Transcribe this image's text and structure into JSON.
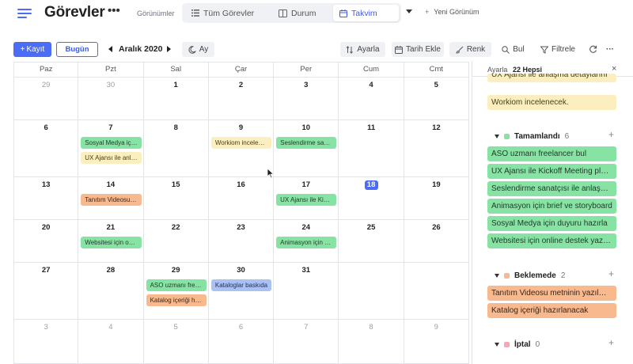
{
  "header": {
    "title": "Görevler",
    "more_label": "•••",
    "views_label": "Görünümler",
    "tabs": [
      {
        "label": "Tüm Görevler",
        "icon": "list-icon"
      },
      {
        "label": "Durum",
        "icon": "board-icon"
      },
      {
        "label": "Takvim",
        "icon": "calendar-icon",
        "active": true
      }
    ],
    "new_view": {
      "plus": "+",
      "label": "Yeni Görünüm"
    }
  },
  "toolbar": {
    "record_label": "Kayıt",
    "record_plus": "+",
    "today_label": "Bugün",
    "month_label": "Aralık 2020",
    "mode_label": "Ay",
    "ayarla_label": "Ayarla",
    "tarih_label": "Tarih Ekle",
    "renk_label": "Renk",
    "bul_label": "Bul",
    "filtre_label": "Filtrele",
    "more_label": "···"
  },
  "colors": {
    "accent": "#4a6cf7",
    "event_green": "#86e3a3",
    "event_yellow": "#fbefbf",
    "event_orange": "#f9b98f",
    "event_blue": "#aac1f3"
  },
  "calendar": {
    "weekdays": [
      "Paz",
      "Pzt",
      "Sal",
      "Çar",
      "Per",
      "Cum",
      "Cmt"
    ],
    "weeks": [
      {
        "days": [
          {
            "num": "29",
            "muted": true
          },
          {
            "num": "30",
            "muted": true
          },
          {
            "num": "1"
          },
          {
            "num": "2"
          },
          {
            "num": "3"
          },
          {
            "num": "4"
          },
          {
            "num": "5"
          }
        ]
      },
      {
        "days": [
          {
            "num": "6"
          },
          {
            "num": "7",
            "events": [
              {
                "text": "Sosyal Medya için duyuru hazırla",
                "color": "green"
              },
              {
                "text": "UX Ajansı ile anlaşma detaylarını",
                "color": "yellow"
              }
            ]
          },
          {
            "num": "8"
          },
          {
            "num": "9",
            "events": [
              {
                "text": "Workiom incelenecek.",
                "color": "yellow"
              }
            ]
          },
          {
            "num": "10",
            "events": [
              {
                "text": "Seslendirme sanatçısı ile anlaşma.",
                "color": "green"
              }
            ]
          },
          {
            "num": "11"
          },
          {
            "num": "12"
          }
        ]
      },
      {
        "days": [
          {
            "num": "13"
          },
          {
            "num": "14",
            "events": [
              {
                "text": "Tanıtım Videosu metninin yazılması",
                "color": "orange"
              }
            ]
          },
          {
            "num": "15"
          },
          {
            "num": "16"
          },
          {
            "num": "17",
            "events": [
              {
                "text": "UX Ajansı ile Kickoff Meeting",
                "color": "green"
              }
            ]
          },
          {
            "num": "18",
            "today": true
          },
          {
            "num": "19"
          }
        ]
      },
      {
        "days": [
          {
            "num": "20"
          },
          {
            "num": "21",
            "events": [
              {
                "text": "Websitesi için online destek yazılımı",
                "color": "green"
              }
            ]
          },
          {
            "num": "22"
          },
          {
            "num": "23"
          },
          {
            "num": "24",
            "events": [
              {
                "text": "Animasyon için brief ve storyboard",
                "color": "green"
              }
            ]
          },
          {
            "num": "25"
          },
          {
            "num": "26"
          }
        ]
      },
      {
        "days": [
          {
            "num": "27"
          },
          {
            "num": "28"
          },
          {
            "num": "29",
            "events": [
              {
                "text": "ASO uzmanı freelancer bul",
                "color": "green"
              },
              {
                "text": "Katalog içeriği hazırlanacak",
                "color": "orange"
              }
            ]
          },
          {
            "num": "30",
            "events": [
              {
                "text": "Kataloglar baskıda",
                "color": "blue"
              }
            ]
          },
          {
            "num": "31"
          },
          {
            "num": ""
          },
          {
            "num": ""
          }
        ]
      },
      {
        "days": [
          {
            "num": "3",
            "muted": true
          },
          {
            "num": "4",
            "muted": true
          },
          {
            "num": "5",
            "muted": true
          },
          {
            "num": "6",
            "muted": true
          },
          {
            "num": "7",
            "muted": true
          },
          {
            "num": "8",
            "muted": true
          },
          {
            "num": "9",
            "muted": true
          }
        ]
      }
    ]
  },
  "panel": {
    "title": "Ayarla",
    "count": "22 Hepsi",
    "close": "×",
    "top_items": [
      {
        "text": "UX Ajansı ile anlaşma detaylarını",
        "color": "yellow"
      },
      {
        "text": "Workiom incelenecek.",
        "color": "yellow"
      }
    ],
    "groups": [
      {
        "name": "Tamamlandı",
        "count": "6",
        "dot_color": "#86e3a3",
        "items": [
          "ASO uzmanı freelancer bul",
          "UX Ajansı ile Kickoff Meeting planla",
          "Seslendirme sanatçısı ile anlaşma.",
          "Animasyon için brief ve storyboard",
          "Sosyal Medya için duyuru hazırla",
          "Websitesi için online destek yazılımı"
        ]
      },
      {
        "name": "Beklemede",
        "count": "2",
        "dot_color": "#f9b98f",
        "items": [
          "Tanıtım Videosu metninin yazılması",
          "Katalog içeriği hazırlanacak"
        ]
      },
      {
        "name": "İptal",
        "count": "0",
        "dot_color": "#f4a7b5",
        "items": []
      }
    ],
    "plus": "+"
  }
}
